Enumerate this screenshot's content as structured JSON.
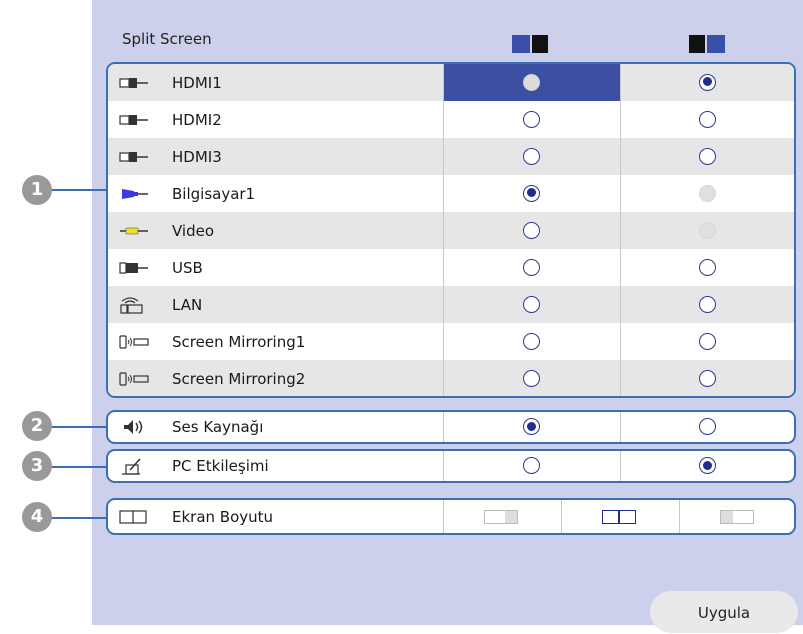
{
  "title": "Split Screen",
  "sources": [
    {
      "label": "HDMI1",
      "icon": "hdmi-icon",
      "left": "disabled-selected",
      "right": "selected"
    },
    {
      "label": "HDMI2",
      "icon": "hdmi-icon",
      "left": "off",
      "right": "off"
    },
    {
      "label": "HDMI3",
      "icon": "hdmi-icon",
      "left": "off",
      "right": "off"
    },
    {
      "label": "Bilgisayar1",
      "icon": "computer-icon",
      "left": "selected",
      "right": "disabled"
    },
    {
      "label": "Video",
      "icon": "video-icon",
      "left": "off",
      "right": "disabled"
    },
    {
      "label": "USB",
      "icon": "usb-icon",
      "left": "off",
      "right": "off"
    },
    {
      "label": "LAN",
      "icon": "lan-icon",
      "left": "off",
      "right": "off"
    },
    {
      "label": "Screen Mirroring1",
      "icon": "screen-mirroring-icon",
      "left": "off",
      "right": "off"
    },
    {
      "label": "Screen Mirroring2",
      "icon": "screen-mirroring-icon",
      "left": "off",
      "right": "off"
    }
  ],
  "audio": {
    "label": "Ses Kaynağı",
    "icon": "speaker-icon",
    "left": "selected",
    "right": "off"
  },
  "pc_interaction": {
    "label": "PC Etkileşimi",
    "icon": "pen-icon",
    "left": "off",
    "right": "selected"
  },
  "screen_size": {
    "label": "Ekran Boyutu",
    "icon": "screen-size-icon",
    "selected": "equal"
  },
  "callouts": [
    "1",
    "2",
    "3",
    "4"
  ],
  "apply_label": "Uygula",
  "colors": {
    "accent": "#3a6fb5",
    "panel": "#ccd0ea",
    "highlight": "#3d4fa3",
    "radio": "#1e2e8a"
  }
}
